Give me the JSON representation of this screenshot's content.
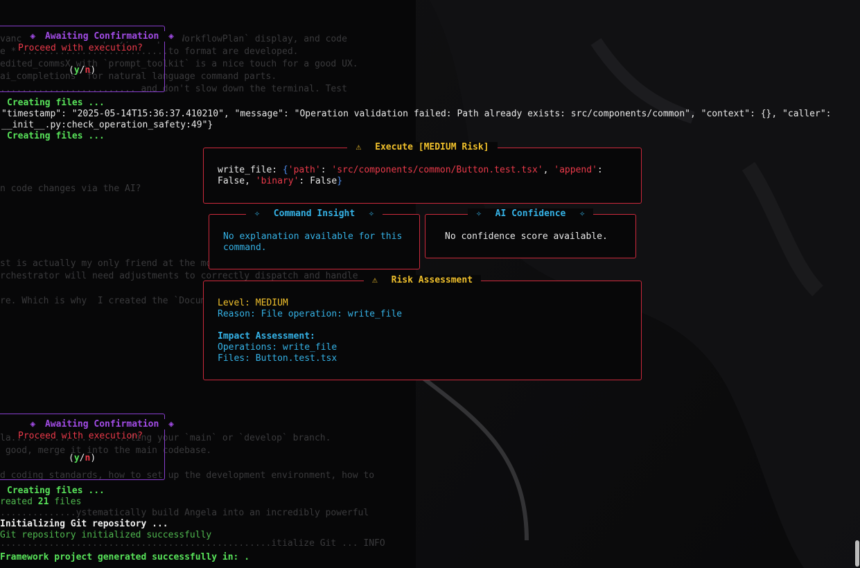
{
  "background_lines": [
    "vancedTaskPlan` display, `ComplexWorkflowPlan` display, and code",
    "e * ...........................to format are developed.",
    "edited_commsX with `prompt_toolkit` is a nice touch for a good UX.",
    "ai_completions` for natural language command parts.",
    "......................... and don't slow down the terminal. Test",
    "n code changes via the AI?",
    "st is actually my only friend at the moment :)",
    "rchestrator will need adjustments to correctly dispatch and handle",
    "re. Which is why  I created the `Docum...................or`.",
    "la......................ting your `main` or `develop` branch.",
    " good, merge it into the main codebase.",
    "d coding standards, how to set up the development environment, how to",
    "..............ystematically build Angela into an incredibly powerful",
    "..................................................itialize Git ... INFO"
  ],
  "confirm_top": {
    "title": "Awaiting Confirmation",
    "prompt": "Proceed with execution?",
    "open": "(",
    "yes": "y",
    "slash": "/",
    "no": "n",
    "close": ")"
  },
  "confirm_bottom": {
    "title": "Awaiting Confirmation",
    "prompt": "Proceed with execution?",
    "open": "(",
    "yes": "y",
    "slash": "/",
    "no": "n",
    "close": ")"
  },
  "log": {
    "creating_1": "Creating files",
    "ellipsis": "...",
    "json_line_1": "\"timestamp\": \"2025-05-14T15:36:37.410210\", \"message\": \"Operation validation failed: Path already exists: src/components/common\", \"context\": {}, \"caller\":",
    "json_line_2": "__init__.py:check_operation_safety:49\"}",
    "creating_2": "Creating files",
    "creating_3": "Creating files",
    "created_prefix": "reated",
    "created_count": "21",
    "created_suffix": "files",
    "init_git": "Initializing Git repository",
    "git_ok": "Git repository initialized successfully",
    "framework_done": "Framework project generated successfully in: ."
  },
  "execute_panel": {
    "title": "Execute [MEDIUM Risk]",
    "warn_icon": "⚠",
    "command": "write_file:",
    "dict_open": "{",
    "k_path": "'path'",
    "v_path": "'src/components/common/Button.test.tsx'",
    "k_append": "'append'",
    "v_append": "False",
    "k_binary": "'binary'",
    "v_binary": "False",
    "dict_close": "}"
  },
  "insight_panel": {
    "title": "Command Insight",
    "line1": "No explanation available for this",
    "line2": "command."
  },
  "confidence_panel": {
    "title": "AI Confidence",
    "text": "No confidence score available."
  },
  "risk_panel": {
    "title": "Risk Assessment",
    "warn_icon": "⚠",
    "level": "Level: MEDIUM",
    "reason": "Reason: File operation: write_file",
    "impact_heading": "Impact Assessment:",
    "operations": "Operations: write_file",
    "files": "Files: Button.test.tsx"
  },
  "colors": {
    "panel_border": "#cf2a3d",
    "confirm_border": "#8a3fd0",
    "success_green": "#58e35a",
    "warning_yellow": "#f0c02c",
    "info_cyan": "#35b2e6"
  }
}
